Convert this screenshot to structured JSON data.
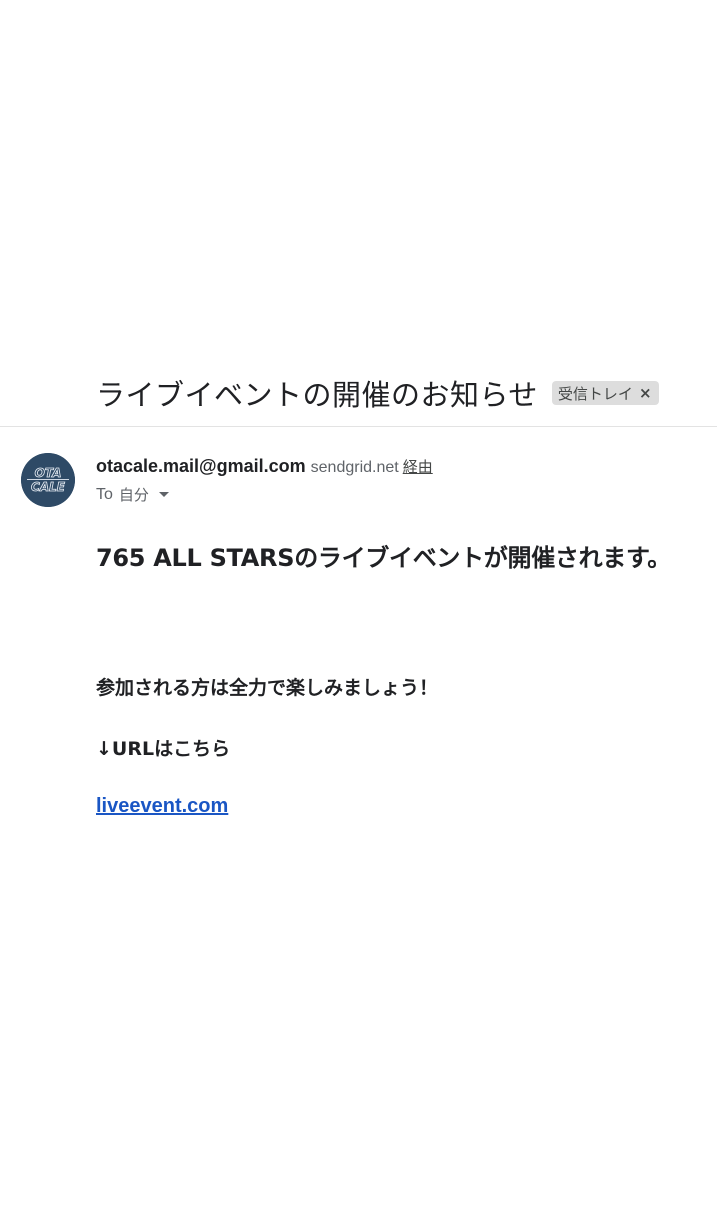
{
  "email": {
    "subject": "ライブイベントの開催のお知らせ",
    "label": {
      "text": "受信トレイ",
      "close_glyph": "×"
    },
    "sender": {
      "email": "otacale.mail@gmail.com",
      "via_domain": "sendgrid.net",
      "via_label": "経由",
      "avatar": {
        "icon": "otacale-logo-icon",
        "line1": "OTA",
        "line2": "CALE",
        "color": "#2e4a66"
      }
    },
    "recipient": {
      "prefix": "To",
      "name": "自分",
      "dropdown_icon": "caret-down-icon"
    },
    "body": {
      "headline": "765 ALL STARSのライブイベントが開催されます。",
      "paragraph1": "参加される方は全力で楽しみましょう！",
      "paragraph2": "↓URLはこちら",
      "link_text": "liveevent.com",
      "link_color": "#1a56c4"
    }
  }
}
